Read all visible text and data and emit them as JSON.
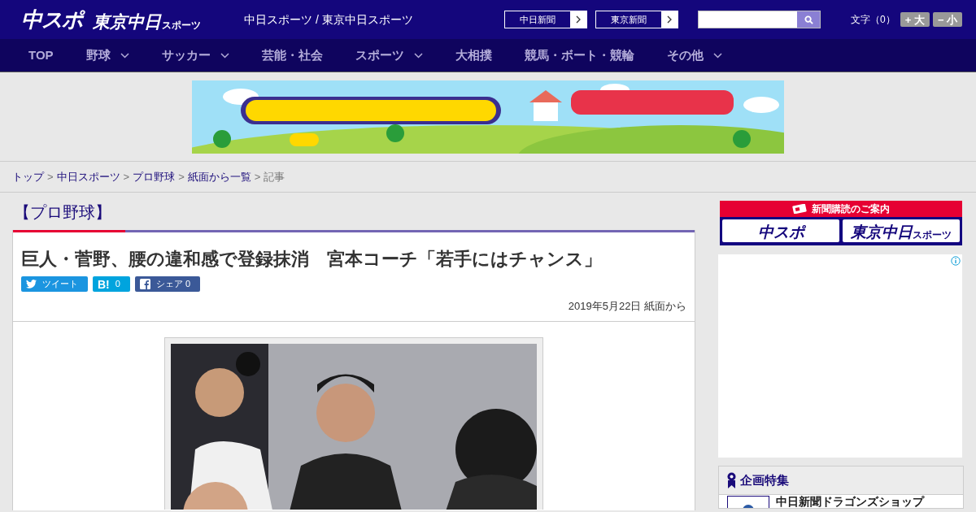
{
  "header": {
    "logo": "中スポ",
    "logo_2": "東京中日",
    "logo_2_small": "スポーツ",
    "tagline": "中日スポーツ / 東京中日スポーツ",
    "paper_links": [
      "中日新聞",
      "東京新聞"
    ],
    "font_size_label": "文字（0）",
    "font_buttons": [
      "+ 大",
      "− 小"
    ]
  },
  "nav": [
    {
      "label": "TOP",
      "dropdown": false
    },
    {
      "label": "野球",
      "dropdown": true
    },
    {
      "label": "サッカー",
      "dropdown": true
    },
    {
      "label": "芸能・社会",
      "dropdown": false
    },
    {
      "label": "スポーツ",
      "dropdown": true
    },
    {
      "label": "大相撲",
      "dropdown": false
    },
    {
      "label": "競馬・ボート・競輪",
      "dropdown": false
    },
    {
      "label": "その他",
      "dropdown": true
    }
  ],
  "breadcrumb": [
    {
      "label": "トップ",
      "link": true
    },
    {
      "separator": ">",
      "label": "中日スポーツ",
      "link": true
    },
    {
      "separator": ">",
      "label": "プロ野球",
      "link": true
    },
    {
      "separator": ">",
      "label": "紙面から一覧",
      "link": true
    },
    {
      "separator": ">",
      "label": "記事",
      "link": false
    }
  ],
  "article": {
    "category": "【プロ野球】",
    "title": "巨人・菅野、腰の違和感で登録抹消　宮本コーチ「若手にはチャンス」",
    "share": [
      {
        "kind": "twitter",
        "label": "ツイート"
      },
      {
        "kind": "hatena",
        "mark": "B!",
        "label": "0"
      },
      {
        "kind": "facebook",
        "label": "シェア 0"
      }
    ],
    "date": "2019年5月22日 紙面から"
  },
  "sidebar": {
    "subscription_title": "新聞購読のご案内",
    "subscription_logos": [
      {
        "text": "中スポ"
      },
      {
        "text": "東京中日",
        "small": "スポーツ"
      }
    ],
    "feature_title": "企画特集",
    "feature_items": [
      "中日新聞ドラゴンズショップ"
    ]
  }
}
